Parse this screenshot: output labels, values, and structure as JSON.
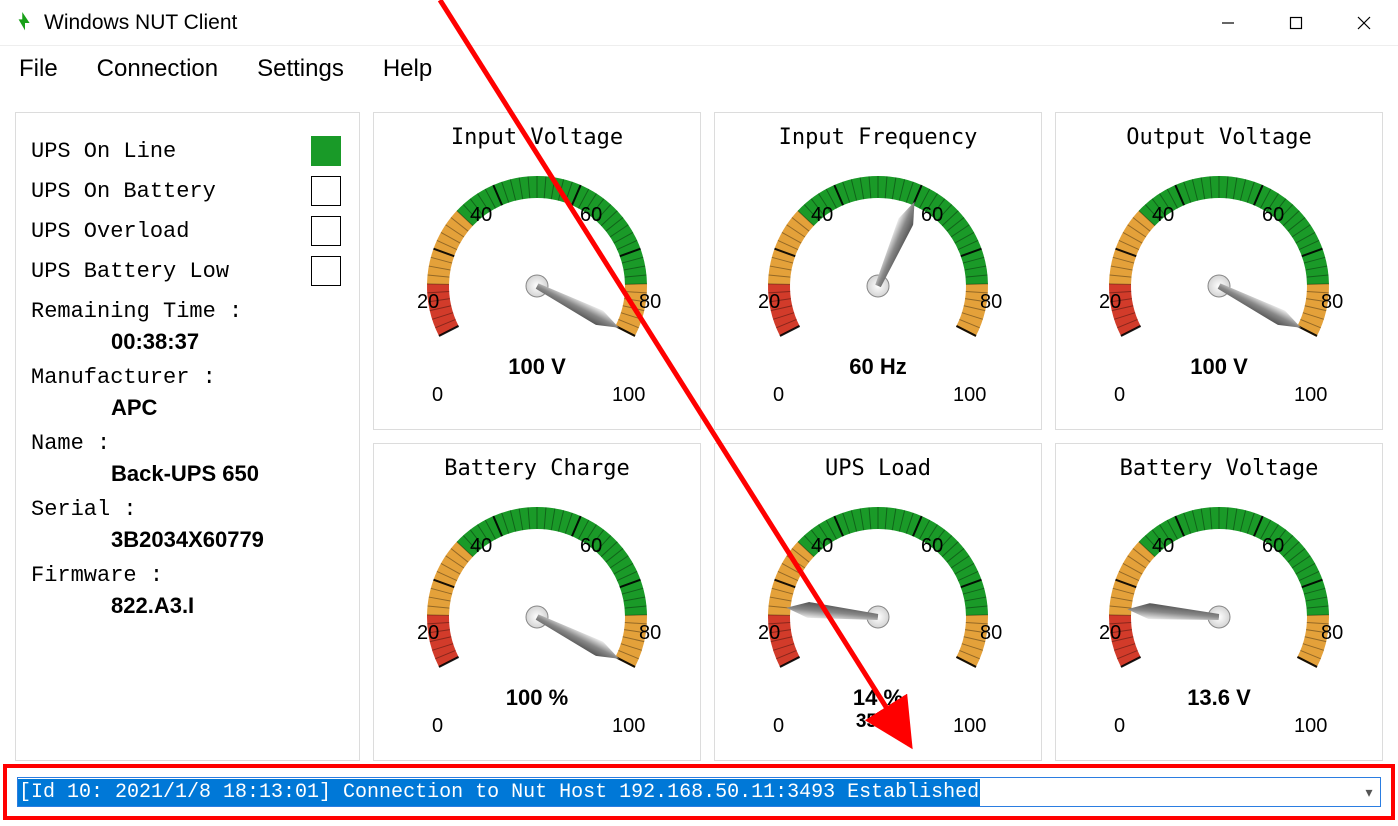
{
  "window": {
    "title": "Windows NUT Client"
  },
  "menu": {
    "file": "File",
    "connection": "Connection",
    "settings": "Settings",
    "help": "Help"
  },
  "status": {
    "online": {
      "label": "UPS On Line",
      "on": true
    },
    "onbattery": {
      "label": "UPS On Battery",
      "on": false
    },
    "overload": {
      "label": "UPS Overload",
      "on": false
    },
    "battlow": {
      "label": "UPS Battery Low",
      "on": false
    }
  },
  "info": {
    "remaining_label": "Remaining Time :",
    "remaining_value": "00:38:37",
    "manufacturer_label": "Manufacturer :",
    "manufacturer_value": "APC",
    "name_label": "Name :",
    "name_value": "Back-UPS 650",
    "serial_label": "Serial :",
    "serial_value": "3B2034X60779",
    "firmware_label": "Firmware :",
    "firmware_value": "822.A3.I"
  },
  "gauges": {
    "input_voltage": {
      "title": "Input Voltage",
      "reading": "100 V",
      "value_pct": 100
    },
    "input_frequency": {
      "title": "Input Frequency",
      "reading": "60 Hz",
      "value_pct": 60
    },
    "output_voltage": {
      "title": "Output Voltage",
      "reading": "100 V",
      "value_pct": 100
    },
    "battery_charge": {
      "title": "Battery Charge",
      "reading": "100 %",
      "value_pct": 100
    },
    "ups_load": {
      "title": "UPS Load",
      "reading": "14 %",
      "sub": "35 W",
      "value_pct": 14
    },
    "battery_voltage": {
      "title": "Battery Voltage",
      "reading": "13.6 V",
      "value_pct": 13.6
    }
  },
  "scale": {
    "t0": "0",
    "t20": "20",
    "t40": "40",
    "t60": "60",
    "t80": "80",
    "t100": "100"
  },
  "statusbar": {
    "text": "[Id 10: 2021/1/8 18:13:01] Connection to Nut Host 192.168.50.11:3493 Established"
  },
  "chart_data": [
    {
      "type": "gauge",
      "title": "Input Voltage",
      "value": 100,
      "unit": "V",
      "min": 0,
      "max": 100,
      "ticks": [
        0,
        20,
        40,
        60,
        80,
        100
      ]
    },
    {
      "type": "gauge",
      "title": "Input Frequency",
      "value": 60,
      "unit": "Hz",
      "min": 0,
      "max": 100,
      "ticks": [
        0,
        20,
        40,
        60,
        80,
        100
      ]
    },
    {
      "type": "gauge",
      "title": "Output Voltage",
      "value": 100,
      "unit": "V",
      "min": 0,
      "max": 100,
      "ticks": [
        0,
        20,
        40,
        60,
        80,
        100
      ]
    },
    {
      "type": "gauge",
      "title": "Battery Charge",
      "value": 100,
      "unit": "%",
      "min": 0,
      "max": 100,
      "ticks": [
        0,
        20,
        40,
        60,
        80,
        100
      ]
    },
    {
      "type": "gauge",
      "title": "UPS Load",
      "value": 14,
      "unit": "%",
      "secondary": "35 W",
      "min": 0,
      "max": 100,
      "ticks": [
        0,
        20,
        40,
        60,
        80,
        100
      ]
    },
    {
      "type": "gauge",
      "title": "Battery Voltage",
      "value": 13.6,
      "unit": "V",
      "min": 0,
      "max": 100,
      "ticks": [
        0,
        20,
        40,
        60,
        80,
        100
      ]
    }
  ]
}
